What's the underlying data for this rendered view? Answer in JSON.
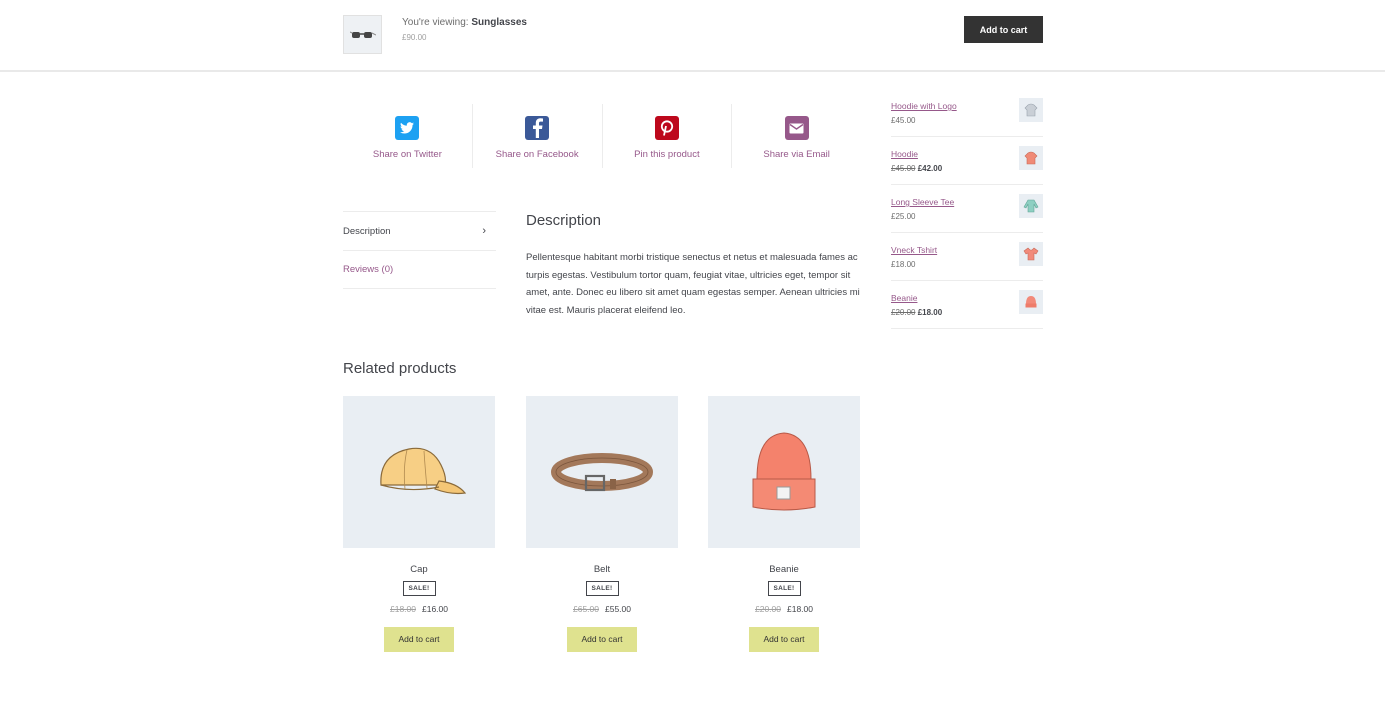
{
  "sticky": {
    "viewing_prefix": "You're viewing: ",
    "product_name": "Sunglasses",
    "price": "£90.00",
    "add_to_cart": "Add to cart"
  },
  "share": [
    {
      "label": "Share on Twitter",
      "icon": "twitter-icon",
      "color": "#1da1f2"
    },
    {
      "label": "Share on Facebook",
      "icon": "facebook-icon",
      "color": "#3b5998"
    },
    {
      "label": "Pin this product",
      "icon": "pinterest-icon",
      "color": "#bd081c"
    },
    {
      "label": "Share via Email",
      "icon": "email-icon",
      "color": "#96588a"
    }
  ],
  "tabs": [
    {
      "label": "Description"
    },
    {
      "label": "Reviews (0)"
    }
  ],
  "description": {
    "title": "Description",
    "text": "Pellentesque habitant morbi tristique senectus et netus et malesuada fames ac turpis egestas. Vestibulum tortor quam, feugiat vitae, ultricies eget, tempor sit amet, ante. Donec eu libero sit amet quam egestas semper. Aenean ultricies mi vitae est. Mauris placerat eleifend leo."
  },
  "widget": [
    {
      "name": "Hoodie with Logo",
      "old_price": "",
      "price": "£45.00",
      "icon": "hoodie-icon",
      "color": "#c9cfd6"
    },
    {
      "name": "Hoodie",
      "old_price": "£45.00",
      "price": "£42.00",
      "icon": "hoodie-icon",
      "color": "#f08a76"
    },
    {
      "name": "Long Sleeve Tee",
      "old_price": "",
      "price": "£25.00",
      "icon": "long-sleeve-tee-icon",
      "color": "#8ecfc2"
    },
    {
      "name": "Vneck Tshirt",
      "old_price": "",
      "price": "£18.00",
      "icon": "tshirt-icon",
      "color": "#f28a7a"
    },
    {
      "name": "Beanie",
      "old_price": "£20.00",
      "price": "£18.00",
      "icon": "beanie-icon",
      "color": "#f28a7a"
    }
  ],
  "related": {
    "title": "Related products",
    "products": [
      {
        "name": "Cap",
        "sale": "SALE!",
        "old_price": "£18.00",
        "price": "£16.00",
        "add_to_cart": "Add to cart"
      },
      {
        "name": "Belt",
        "sale": "SALE!",
        "old_price": "£65.00",
        "price": "£55.00",
        "add_to_cart": "Add to cart"
      },
      {
        "name": "Beanie",
        "sale": "SALE!",
        "old_price": "£20.00",
        "price": "£18.00",
        "add_to_cart": "Add to cart"
      }
    ]
  },
  "colors": {
    "accent": "#96588a",
    "button_dark": "#333333",
    "button_light": "#dfe28f",
    "image_bg": "#e9eef3"
  }
}
